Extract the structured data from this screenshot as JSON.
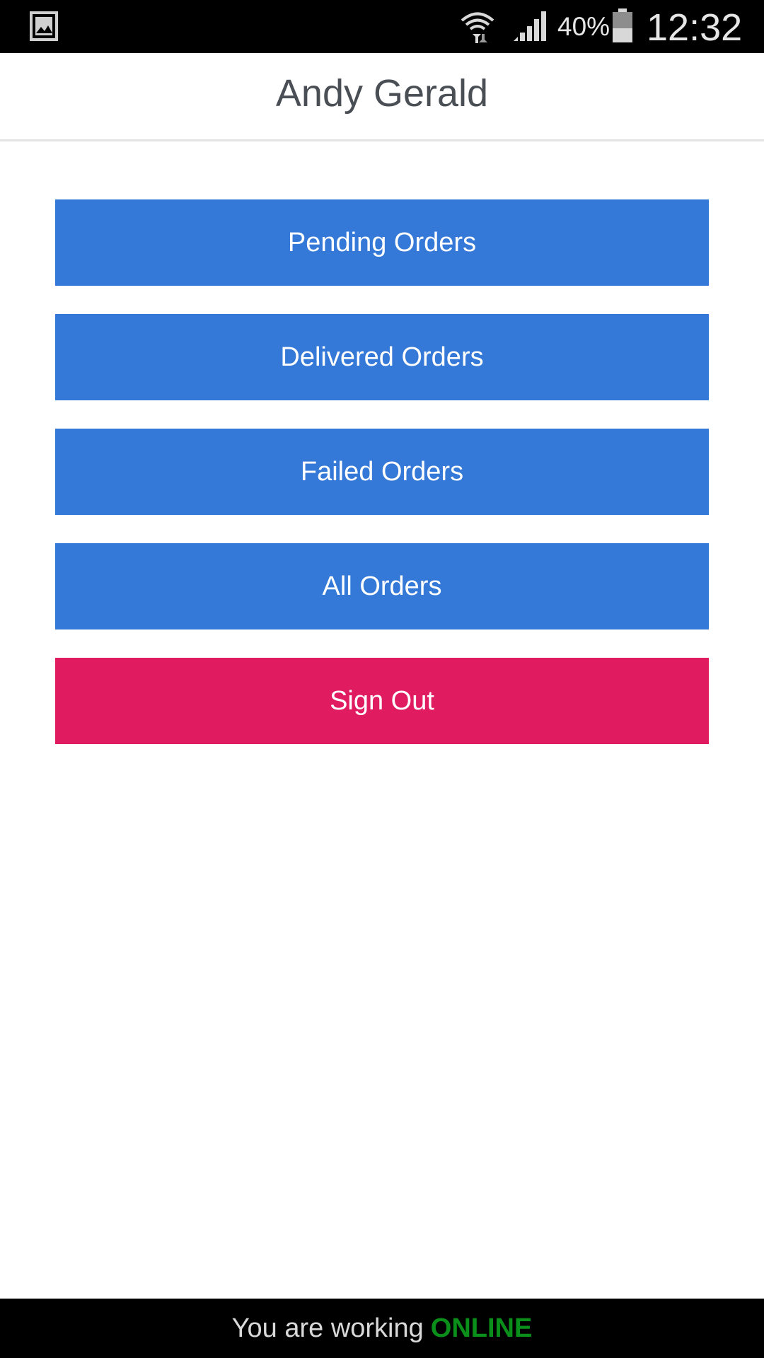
{
  "status_bar": {
    "left_icon": "gallery-icon",
    "wifi_icon": "wifi-icon",
    "signal_icon": "signal-icon",
    "battery_percent": "40%",
    "battery_icon": "battery-icon",
    "time": "12:32"
  },
  "header": {
    "title": "Andy Gerald"
  },
  "menu": {
    "pending_orders": "Pending Orders",
    "delivered_orders": "Delivered Orders",
    "failed_orders": "Failed Orders",
    "all_orders": "All Orders",
    "sign_out": "Sign Out"
  },
  "colors": {
    "primary_button": "#3478d8",
    "danger_button": "#e01b5f",
    "online_status": "#0a8f1a"
  },
  "footer": {
    "message": "You are working",
    "status": "ONLINE"
  }
}
